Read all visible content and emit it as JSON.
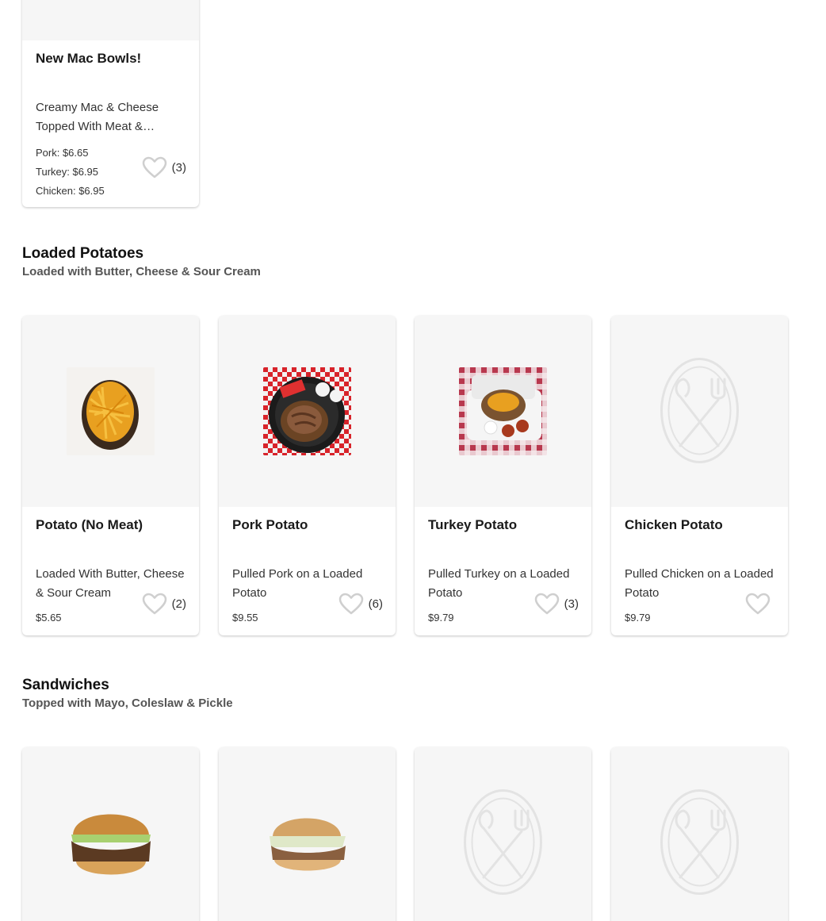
{
  "mac_card": {
    "title": "New Mac Bowls!",
    "description": "Creamy Mac & Cheese Topped With Meat &…",
    "prices": [
      "Pork: $6.65",
      "Turkey: $6.95",
      "Chicken: $6.95"
    ],
    "fav_count": "(3)"
  },
  "loaded_potatoes": {
    "title": "Loaded Potatoes",
    "subtitle": "Loaded with Butter, Cheese & Sour Cream",
    "items": [
      {
        "title": "Potato (No Meat)",
        "description": "Loaded With Butter, Cheese & Sour Cream",
        "price": "$5.65",
        "fav_count": "(2)",
        "image": "plain-loaded-potato"
      },
      {
        "title": "Pork Potato",
        "description": "Pulled Pork on a Loaded Potato",
        "price": "$9.55",
        "fav_count": "(6)",
        "image": "pork-potato"
      },
      {
        "title": "Turkey Potato",
        "description": "Pulled Turkey on a Loaded Potato",
        "price": "$9.79",
        "fav_count": "(3)",
        "image": "turkey-potato"
      },
      {
        "title": "Chicken Potato",
        "description": "Pulled Chicken on a Loaded Potato",
        "price": "$9.79",
        "fav_count": "",
        "image": "placeholder"
      }
    ]
  },
  "sandwiches": {
    "title": "Sandwiches",
    "subtitle": "Topped with Mayo, Coleslaw & Pickle"
  },
  "colors": {
    "card_image_bg": "#f6f6f6",
    "heart_outline": "#cfcfcf",
    "placeholder": "#e3e3e3"
  }
}
